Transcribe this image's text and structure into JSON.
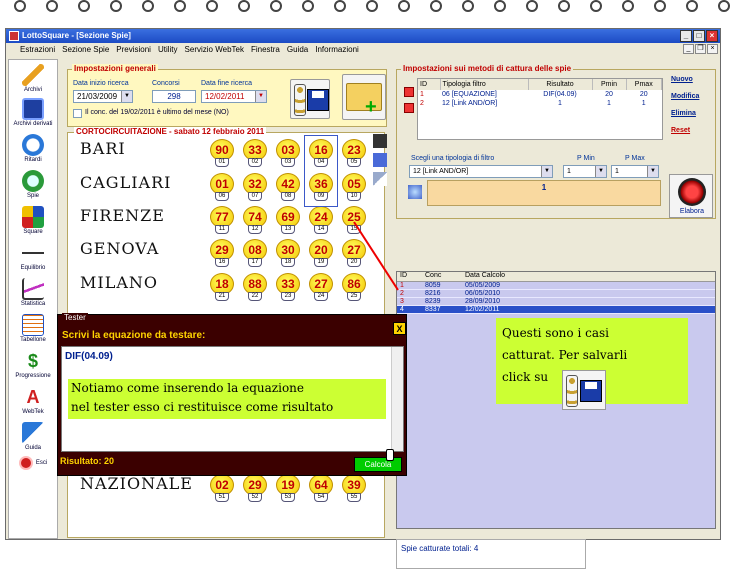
{
  "title": "LottoSquare - [Sezione Spie]",
  "menu": [
    "Estrazioni",
    "Sezione Spie",
    "Previsioni",
    "Utility",
    "Servizio WebTek",
    "Finestra",
    "Guida",
    "Informazioni"
  ],
  "leftbar": [
    "Archivi",
    "Archivi derivati",
    "Ritardi",
    "Spie",
    "Square",
    "Equilibrio",
    "Statistica",
    "Tabellone",
    "Progressione",
    "WebTek",
    "Guida",
    "Esci"
  ],
  "general": {
    "legend": "Impostazioni generali",
    "data_inizio_label": "Data inizio ricerca",
    "data_inizio": "21/03/2009",
    "concorsi_label": "Concorsi",
    "concorsi": "298",
    "data_fine_label": "Data fine ricerca",
    "data_fine": "12/02/2011",
    "checkbox_label": "Il conc. del 19/02/2011 è ultimo del mese (NO)"
  },
  "cort_title": "CORTOCIRCUITAZIONE - sabato 12 febbraio 2011",
  "wheels": [
    {
      "name": "BARI",
      "nums": [
        "90",
        "33",
        "03",
        "16",
        "23"
      ],
      "pos": [
        "01",
        "02",
        "03",
        "04",
        "05"
      ]
    },
    {
      "name": "CAGLIARI",
      "nums": [
        "01",
        "32",
        "42",
        "36",
        "05"
      ],
      "pos": [
        "06",
        "07",
        "08",
        "09",
        "10"
      ]
    },
    {
      "name": "FIRENZE",
      "nums": [
        "77",
        "74",
        "69",
        "24",
        "25"
      ],
      "pos": [
        "11",
        "12",
        "13",
        "14",
        "15"
      ]
    },
    {
      "name": "GENOVA",
      "nums": [
        "29",
        "08",
        "30",
        "20",
        "27"
      ],
      "pos": [
        "16",
        "17",
        "18",
        "19",
        "20"
      ]
    },
    {
      "name": "MILANO",
      "nums": [
        "18",
        "88",
        "33",
        "27",
        "86"
      ],
      "pos": [
        "21",
        "22",
        "23",
        "24",
        "25"
      ]
    },
    {
      "name": "NAZIONALE",
      "nums": [
        "02",
        "29",
        "19",
        "64",
        "39"
      ],
      "pos": [
        "51",
        "52",
        "53",
        "54",
        "55"
      ]
    }
  ],
  "metodi": {
    "legend": "Impostazioni sui metodi di cattura delle spie",
    "headers": [
      "ID",
      "Tipologia filtro",
      "Risultato",
      "Pmin",
      "Pmax"
    ],
    "rows": [
      [
        "1",
        "06 [EQUAZIONE]",
        "DIF(04.09)",
        "20",
        "20"
      ],
      [
        "2",
        "12 [Link AND/OR]",
        "1",
        "1",
        "1"
      ]
    ],
    "links": [
      "Nuovo",
      "Modifica",
      "Elimina",
      "Reset"
    ],
    "scegli_label": "Scegli una tipologia di filtro",
    "pmin_label": "P Min",
    "pmax_label": "P Max",
    "tipologia": "12 [Link AND/OR]",
    "pmin": "1",
    "pmax": "1",
    "value": "1",
    "elabora": "Elabora"
  },
  "conc": {
    "headers": [
      "ID",
      "Conc",
      "Data Calcolo"
    ],
    "rows": [
      [
        "1",
        "8059",
        "05/05/2009"
      ],
      [
        "2",
        "8216",
        "06/05/2010"
      ],
      [
        "3",
        "8239",
        "28/09/2010"
      ],
      [
        "4",
        "8337",
        "12/02/2011"
      ]
    ]
  },
  "spie_totali": "Spie catturate totali: 4",
  "tester": {
    "title": "Tester",
    "close": "X",
    "prompt": "Scrivi la equazione da testare:",
    "equation": "DIF(04.09)",
    "result": "Risultato: 20",
    "calc": "Calcola"
  },
  "notes": {
    "note1_line1": "Notiamo come inserendo la equazione",
    "note1_line2": "nel tester esso ci restituisce come risultato",
    "note2_line1": "Questi sono i casi",
    "note2_line2": "catturat. Per salvarli",
    "note2_line3": "click su"
  },
  "colors": {
    "accent": "#c00000",
    "link": "#00208f",
    "note": "#ccff33",
    "bulb": "#ffe200"
  }
}
